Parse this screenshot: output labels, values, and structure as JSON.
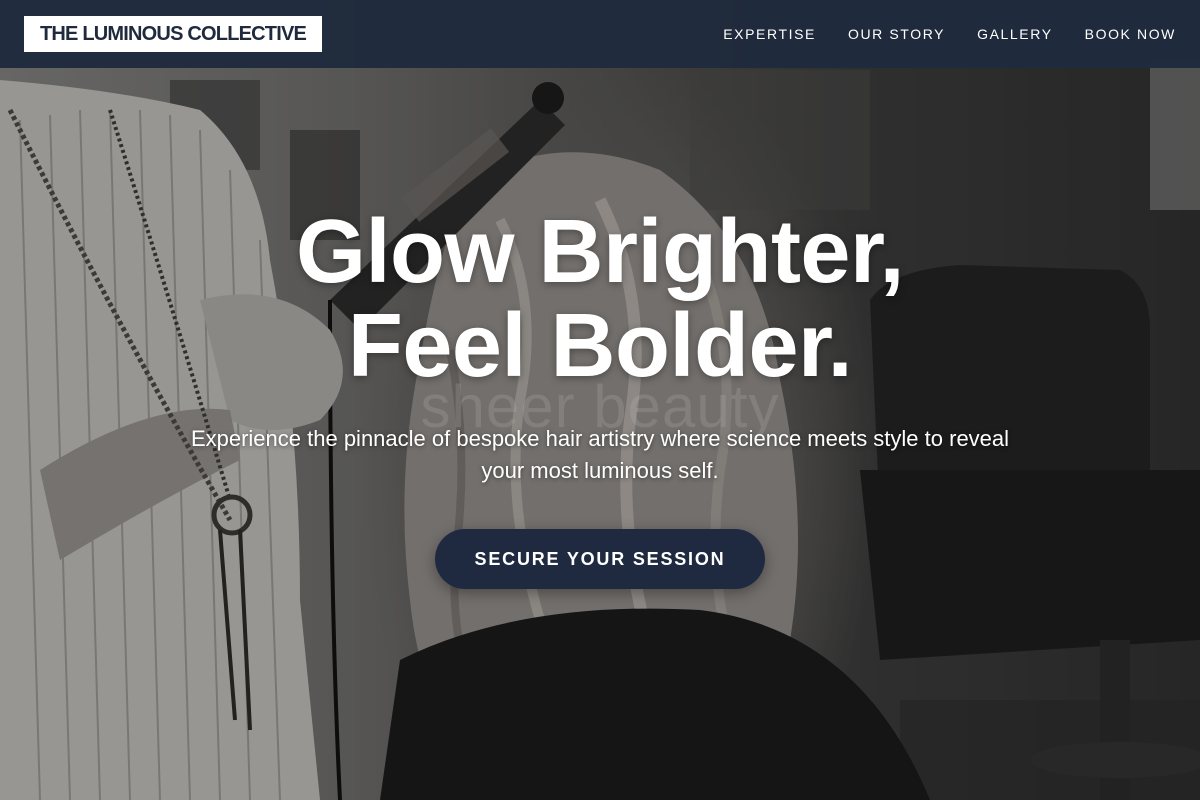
{
  "nav": {
    "logo": "THE LUMINOUS COLLECTIVE",
    "links": [
      {
        "label": "EXPERTISE"
      },
      {
        "label": "OUR STORY"
      },
      {
        "label": "GALLERY"
      },
      {
        "label": "BOOK NOW"
      }
    ]
  },
  "hero": {
    "headline_line1": "Glow Brighter,",
    "headline_line2": "Feel Bolder.",
    "subtext": "Experience the pinnacle of bespoke hair artistry where science meets style to reveal your most luminous self.",
    "cta_label": "SECURE YOUR SESSION",
    "watermark": "sheer beauty",
    "image": "black-and-white photo of a stylist curling a client's hair in a salon"
  },
  "colors": {
    "nav_bg": "#1f2a3d",
    "cta_bg": "#1f2a40",
    "text": "#ffffff"
  }
}
